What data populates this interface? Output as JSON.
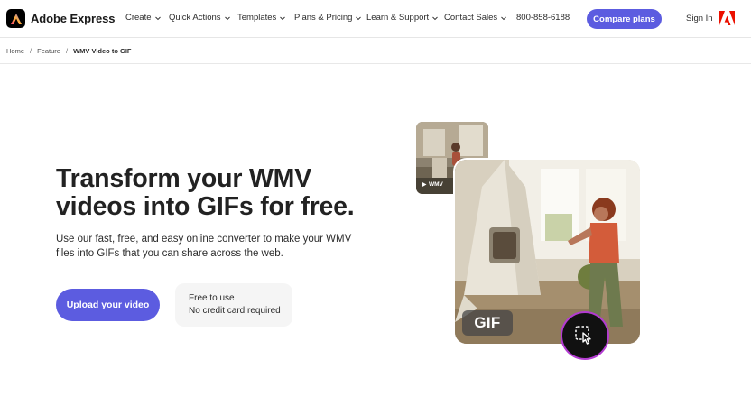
{
  "brand": {
    "name": "Adobe Express"
  },
  "nav": {
    "items": [
      {
        "label": "Create"
      },
      {
        "label": "Quick Actions"
      },
      {
        "label": "Templates"
      },
      {
        "label": "Plans & Pricing"
      },
      {
        "label": "Learn & Support"
      },
      {
        "label": "Contact Sales"
      }
    ],
    "phone": "800-858-6188",
    "cta": "Compare plans",
    "signin": "Sign In"
  },
  "breadcrumb": {
    "items": [
      "Home",
      "Feature",
      "WMV Video to GIF"
    ],
    "separator": "/"
  },
  "hero": {
    "title_line1": "Transform your WMV",
    "title_line2": "videos into GIFs for free.",
    "subtitle": "Use our fast, free, and easy online converter to make your WMV files into GIFs that you can share across the web.",
    "upload_button": "Upload your video",
    "note_line1": "Free to use",
    "note_line2": "No credit card required"
  },
  "media": {
    "source_tag": "WMV",
    "result_tag": "GIF",
    "action_icon": "tap-select-icon"
  },
  "colors": {
    "accent": "#5c5ce0",
    "brand_red": "#eb1000",
    "ring": "#b33bd1"
  }
}
